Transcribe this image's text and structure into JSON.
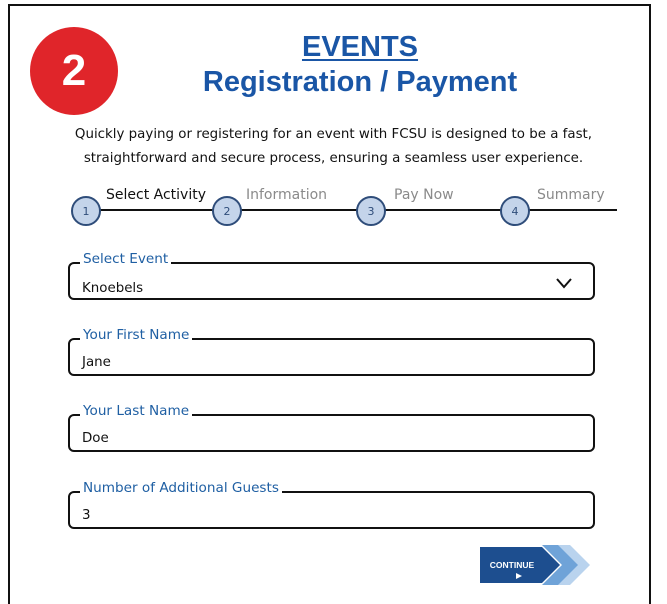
{
  "header": {
    "step_number": "2",
    "title_line1": "EVENTS",
    "title_line2": "Registration / Payment"
  },
  "intro_text": "Quickly paying or registering for an event with FCSU is designed to be a fast, straightforward and secure process, ensuring a seamless user experience.",
  "stepper": {
    "steps": [
      {
        "number": "1",
        "label": "Select Activity",
        "state": "active"
      },
      {
        "number": "2",
        "label": "Information",
        "state": "inactive"
      },
      {
        "number": "3",
        "label": "Pay Now",
        "state": "inactive"
      },
      {
        "number": "4",
        "label": "Summary",
        "state": "inactive"
      }
    ]
  },
  "form": {
    "select_event": {
      "label": "Select Event",
      "value": "Knoebels"
    },
    "first_name": {
      "label": "Your First Name",
      "value": "Jane"
    },
    "last_name": {
      "label": "Your Last Name",
      "value": "Doe"
    },
    "guests": {
      "label": "Number of Additional Guests",
      "value": "3"
    }
  },
  "continue_button": {
    "label": "CONTINUE"
  },
  "colors": {
    "accent": "#1a56a6",
    "badge": "#e0252a",
    "step_circle_fill": "#c4d4ea",
    "step_circle_border": "#2f4d7a",
    "field_label": "#1f5fa3"
  },
  "icons": {
    "dropdown": "chevron-down-icon",
    "continue": "double-chevron-right-icon"
  }
}
